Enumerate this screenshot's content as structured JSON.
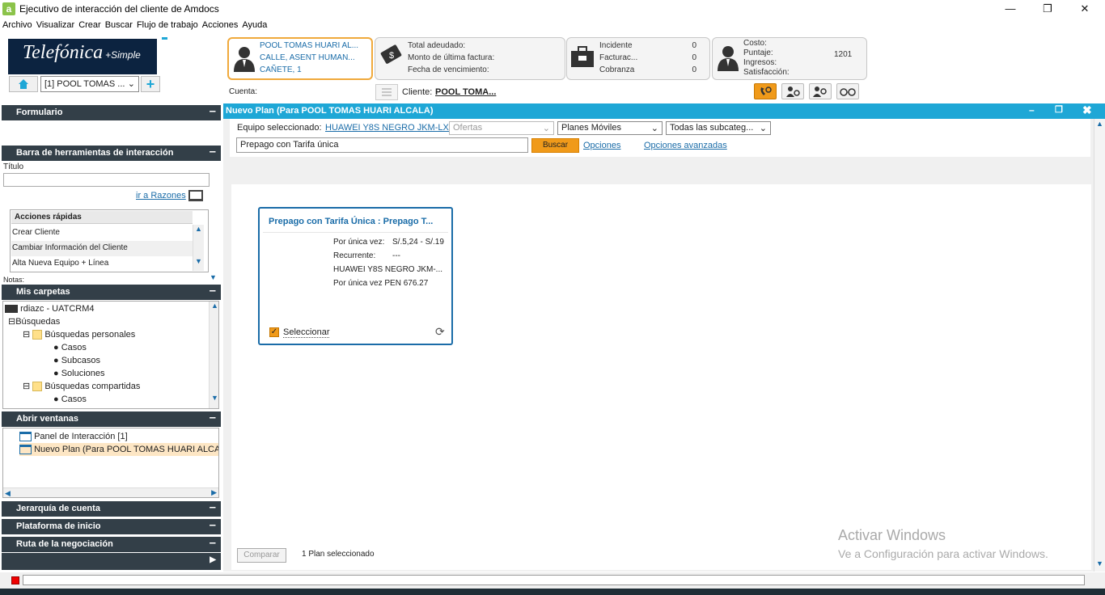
{
  "window": {
    "title": "Ejecutivo de interacción del cliente de Amdocs",
    "app_icon": "a"
  },
  "menu": [
    "Archivo",
    "Visualizar",
    "Crear",
    "Buscar",
    "Flujo de trabajo",
    "Acciones",
    "Ayuda"
  ],
  "brand": {
    "logo_text": "Telefónica",
    "logo_sub": "+Simple"
  },
  "interaction_select": "[1] POOL TOMAS ...",
  "customer_card": {
    "name": "POOL TOMAS HUARI AL...",
    "address1": "CALLE, ASENT HUMAN...",
    "address2": "CAÑETE, 1"
  },
  "billing_card": {
    "labels": [
      "Total adeudado:",
      "Monto de última factura:",
      "Fecha de vencimiento:"
    ]
  },
  "cases_card": {
    "rows": [
      {
        "label": "Incidente",
        "count": "0"
      },
      {
        "label": "Facturac...",
        "count": "0"
      },
      {
        "label": "Cobranza",
        "count": "0"
      }
    ]
  },
  "score_card": {
    "labels": [
      "Costo:",
      "Puntaje:",
      "Ingresos:",
      "Satisfacción:"
    ],
    "puntaje": "1201"
  },
  "cuenta_label": "Cuenta:",
  "cliente_label": "Cliente:",
  "cliente_name": "POOL TOMA...",
  "left": {
    "formulario": "Formulario",
    "toolbar_title": "Barra de herramientas de interacción",
    "titulo_label": "Título",
    "razones_link": "ir a Razones",
    "quick_actions_title": "Acciones rápidas",
    "quick_actions": [
      "Crear Cliente",
      "Cambiar Información del Cliente",
      "Alta Nueva Equipo + Línea"
    ],
    "notas_label": "Notas:",
    "folders_title": "Mis carpetas",
    "folders": {
      "root": "rdiazc - UATCRM4",
      "busquedas": "Búsquedas",
      "personales": "Búsquedas personales",
      "casos": "Casos",
      "subcasos": "Subcasos",
      "soluciones": "Soluciones",
      "compartidas": "Búsquedas compartidas",
      "casos2": "Casos"
    },
    "open_windows_title": "Abrir ventanas",
    "open_windows": [
      "Panel de Interacción  [1]",
      "Nuevo Plan (Para POOL TOMAS HUARI ALCALA"
    ],
    "jerarquia": "Jerarquía de cuenta",
    "plataforma": "Plataforma de inicio",
    "ruta": "Ruta de la negociación"
  },
  "main": {
    "title": "Nuevo Plan (Para POOL TOMAS HUARI ALCALA)",
    "equipo_label": "Equipo seleccionado:",
    "equipo_link": "HUAWEI Y8S NEGRO JKM-LX3",
    "ofertas": "Ofertas",
    "planes": "Planes Móviles",
    "subcateg": "Todas las subcateg...",
    "search_value": "Prepago con Tarifa única",
    "search_btn": "Buscar",
    "opciones": "Opciones",
    "opciones_avanzadas": "Opciones avanzadas",
    "plan": {
      "title": "Prepago con Tarifa Única : Prepago T...",
      "unica_label": "Por única vez:",
      "unica_value": "S/.5,24 - S/.19",
      "recurrente_label": "Recurrente:",
      "recurrente_value": "---",
      "device": "HUAWEI Y8S NEGRO JKM-...",
      "price_line": "Por única vez PEN 676.27",
      "select_label": "Seleccionar"
    },
    "compare_btn": "Comparar",
    "selected_count": "1 Plan seleccionado"
  },
  "watermark": {
    "line1": "Activar Windows",
    "line2": "Ve a Configuración para activar Windows."
  },
  "colors": {
    "accent": "#1ea7d6",
    "header_dark": "#333f48",
    "orange": "#f09a1a",
    "link": "#1a6ca8"
  }
}
